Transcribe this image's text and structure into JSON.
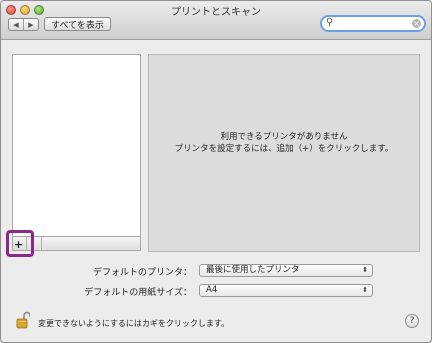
{
  "window": {
    "title": "プリントとスキャン"
  },
  "toolbar": {
    "back_glyph": "◀",
    "forward_glyph": "▶",
    "show_all_label": "すべてを表示",
    "search_placeholder": "",
    "search_icon": "magnifier-icon",
    "search_clear_glyph": "×"
  },
  "printer_list": {
    "items": [],
    "add_label": "+",
    "remove_label": "−"
  },
  "detail": {
    "message_line1": "利用できるプリンタがありません",
    "message_line2": "プリンタを設定するには、追加（+）をクリックします。"
  },
  "settings": {
    "default_printer_label": "デフォルトのプリンタ：",
    "default_printer_value": "最後に使用したプリンタ",
    "default_paper_label": "デフォルトの用紙サイズ：",
    "default_paper_value": "A4"
  },
  "footer": {
    "lock_text": "変更できないようにするにはカギをクリックします。",
    "help_label": "?"
  },
  "colors": {
    "highlight": "#8b2a86",
    "search_focus": "#6aa0e6"
  }
}
